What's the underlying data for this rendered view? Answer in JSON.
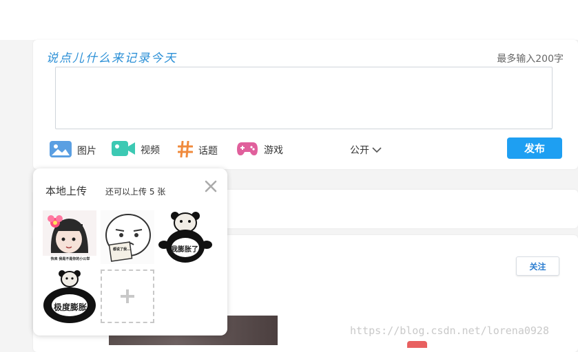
{
  "composer": {
    "prompt": "说点儿什么来记录今天",
    "limit": "最多输入200字",
    "toolbar": [
      {
        "label": "图片",
        "icon": "image-icon",
        "color": "#5a9fe2"
      },
      {
        "label": "视频",
        "icon": "video-icon",
        "color": "#3cc9b3"
      },
      {
        "label": "话题",
        "icon": "hashtag-icon",
        "color": "#f08a3c"
      },
      {
        "label": "游戏",
        "icon": "gamepad-icon",
        "color": "#e0609c"
      }
    ],
    "visibility": "公开",
    "publish": "发布",
    "accent": "#1e9ff2"
  },
  "popup": {
    "title": "本地上传",
    "remaining": "还可以上传 5 张",
    "stickers": [
      {
        "caption": "快来 我是不是你的小公举",
        "icon": "girl-flower-sticker"
      },
      {
        "caption": "都说了我...",
        "icon": "face-note-sticker"
      },
      {
        "caption": "我膨胀了",
        "icon": "panda-sticker"
      },
      {
        "caption": "极度膨胀",
        "icon": "panda-sticker-large"
      }
    ],
    "add_icon": "plus-icon"
  },
  "feed": {
    "follow": "关注"
  },
  "watermark": "https://blog.csdn.net/lorena0928"
}
